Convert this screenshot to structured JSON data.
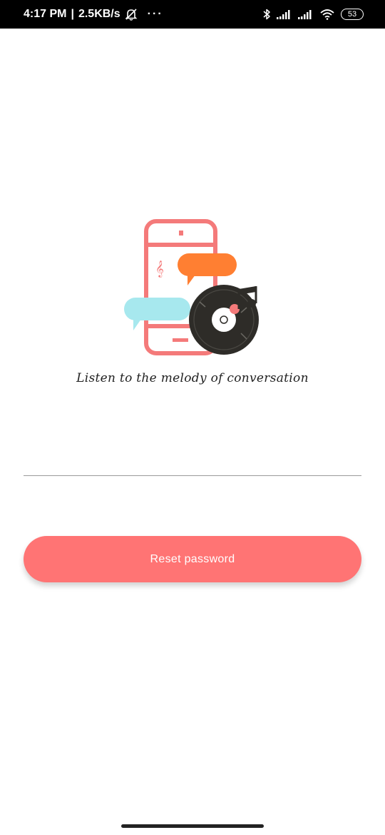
{
  "status_bar": {
    "time": "4:17 PM",
    "separator": "|",
    "net_speed": "2.5KB/s",
    "more": "···",
    "battery": "53"
  },
  "tagline": "Listen to the melody of conversation",
  "email_input": {
    "placeholder": "",
    "value": ""
  },
  "reset_button": {
    "label": "Reset password"
  },
  "colors": {
    "accent": "#ff7474",
    "phone_outline": "#f47a7a",
    "bubble_orange": "#ff7f32",
    "bubble_cyan": "#a7e8ee",
    "record_dark": "#2e2c28"
  },
  "icons": {
    "dnd": "dnd-off-icon",
    "bluetooth": "bluetooth-icon",
    "signal1": "signal-icon",
    "signal2": "signal-icon",
    "wifi": "wifi-icon"
  }
}
